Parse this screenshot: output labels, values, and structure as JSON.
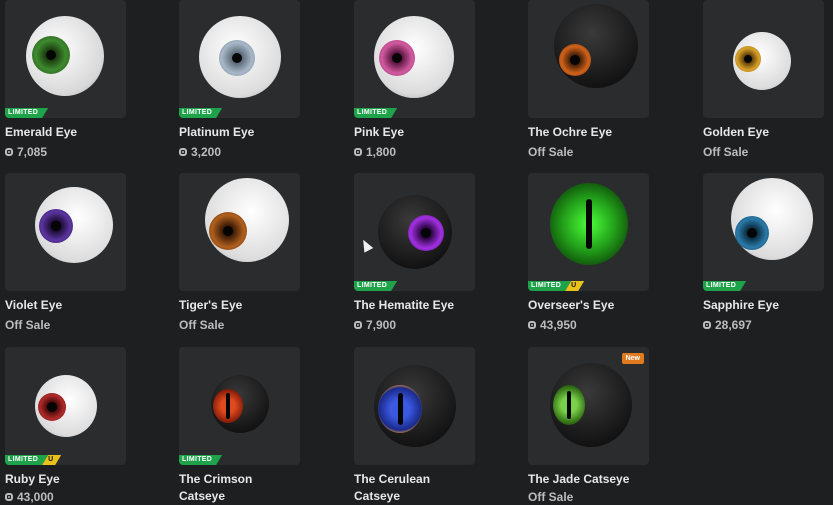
{
  "items": [
    {
      "name": "Emerald Eye",
      "price": "7,085",
      "limited": "LIMITED",
      "iris": "#3e8a2e"
    },
    {
      "name": "Platinum Eye",
      "price": "3,200",
      "limited": "LIMITED",
      "iris": "#8fa0b0"
    },
    {
      "name": "Pink Eye",
      "price": "1,800",
      "limited": "LIMITED",
      "iris": "#c2458e"
    },
    {
      "name": "The Ochre Eye",
      "status": "Off Sale",
      "iris": "#c05a12"
    },
    {
      "name": "Golden Eye",
      "status": "Off Sale",
      "iris": "#c8951e"
    },
    {
      "name": "Violet Eye",
      "status": "Off Sale",
      "iris": "#4b2b82"
    },
    {
      "name": "Tiger's Eye",
      "status": "Off Sale",
      "iris": "#a6551b"
    },
    {
      "name": "The Hematite Eye",
      "price": "7,900",
      "limited": "LIMITED",
      "iris": "#8b22c8"
    },
    {
      "name": "Overseer's Eye",
      "price": "43,950",
      "limited": "LIMITED",
      "unique": "U",
      "iris": "#3bd42a"
    },
    {
      "name": "Sapphire Eye",
      "price": "28,697",
      "limited": "LIMITED",
      "iris": "#1d5f85"
    },
    {
      "name": "Ruby Eye",
      "price": "43,000",
      "limited": "LIMITED",
      "unique": "U",
      "iris": "#a02020"
    },
    {
      "name": "The Crimson Catseye",
      "name_line1": "The Crimson",
      "name_line2": "Catseye",
      "limited": "LIMITED",
      "iris": "#c83a1e"
    },
    {
      "name": "The Cerulean Catseye",
      "name_line1": "The Cerulean",
      "name_line2": "Catseye",
      "iris": "#2d48b8"
    },
    {
      "name": "The Jade Catseye",
      "status": "Off Sale",
      "new": "New",
      "iris": "#4e9a2a"
    }
  ]
}
